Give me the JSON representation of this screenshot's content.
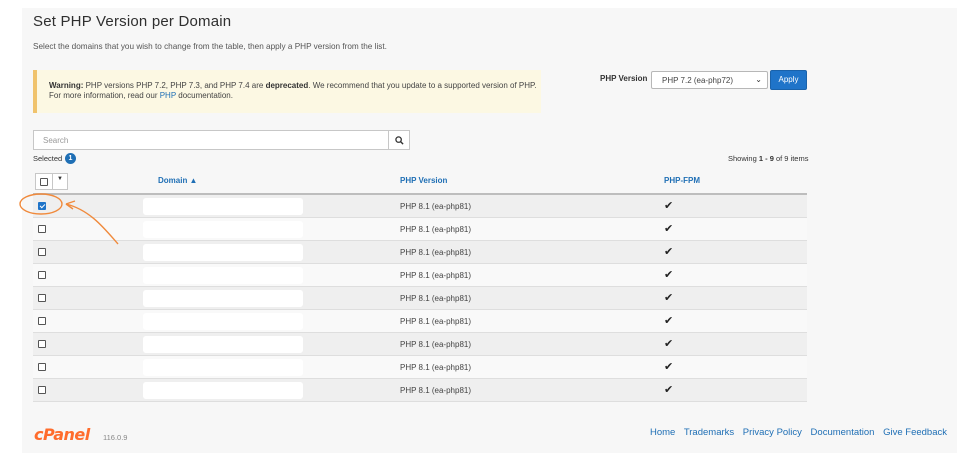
{
  "page": {
    "title": "Set PHP Version per Domain",
    "description": "Select the domains that you wish to change from the table, then apply a PHP version from the list."
  },
  "warning": {
    "prefix": "Warning:",
    "text1": " PHP versions PHP 7.2, PHP 7.3, and PHP 7.4 are ",
    "deprecated": "deprecated",
    "text2": ". We recommend that you update to a supported version of PHP. For more information, read our ",
    "link": "PHP",
    "text3": " documentation."
  },
  "php_selector": {
    "label": "PHP Version",
    "selected": "PHP 7.2 (ea-php72)",
    "apply_label": "Apply"
  },
  "search": {
    "placeholder": "Search"
  },
  "selection": {
    "label": "Selected",
    "count": "1"
  },
  "showing": {
    "prefix": "Showing ",
    "range": "1 - 9",
    "suffix": " of 9 items"
  },
  "table": {
    "columns": [
      "Domain ▲",
      "PHP Version",
      "PHP-FPM"
    ],
    "rows": [
      {
        "checked": true,
        "php_version": "PHP 8.1 (ea-php81)",
        "fpm": "✔"
      },
      {
        "checked": false,
        "php_version": "PHP 8.1 (ea-php81)",
        "fpm": "✔"
      },
      {
        "checked": false,
        "php_version": "PHP 8.1 (ea-php81)",
        "fpm": "✔"
      },
      {
        "checked": false,
        "php_version": "PHP 8.1 (ea-php81)",
        "fpm": "✔"
      },
      {
        "checked": false,
        "php_version": "PHP 8.1 (ea-php81)",
        "fpm": "✔"
      },
      {
        "checked": false,
        "php_version": "PHP 8.1 (ea-php81)",
        "fpm": "✔"
      },
      {
        "checked": false,
        "php_version": "PHP 8.1 (ea-php81)",
        "fpm": "✔"
      },
      {
        "checked": false,
        "php_version": "PHP 8.1 (ea-php81)",
        "fpm": "✔"
      },
      {
        "checked": false,
        "php_version": "PHP 8.1 (ea-php81)",
        "fpm": "✔"
      }
    ]
  },
  "footer": {
    "brand": "cPanel",
    "version": "116.0.9",
    "links": [
      "Home",
      "Trademarks",
      "Privacy Policy",
      "Documentation",
      "Give Feedback"
    ]
  },
  "colors": {
    "accent": "#1f6fb5",
    "brand": "#ff6c2c",
    "warning_bg": "#fcf8e3",
    "annotation": "#f08a3c"
  }
}
